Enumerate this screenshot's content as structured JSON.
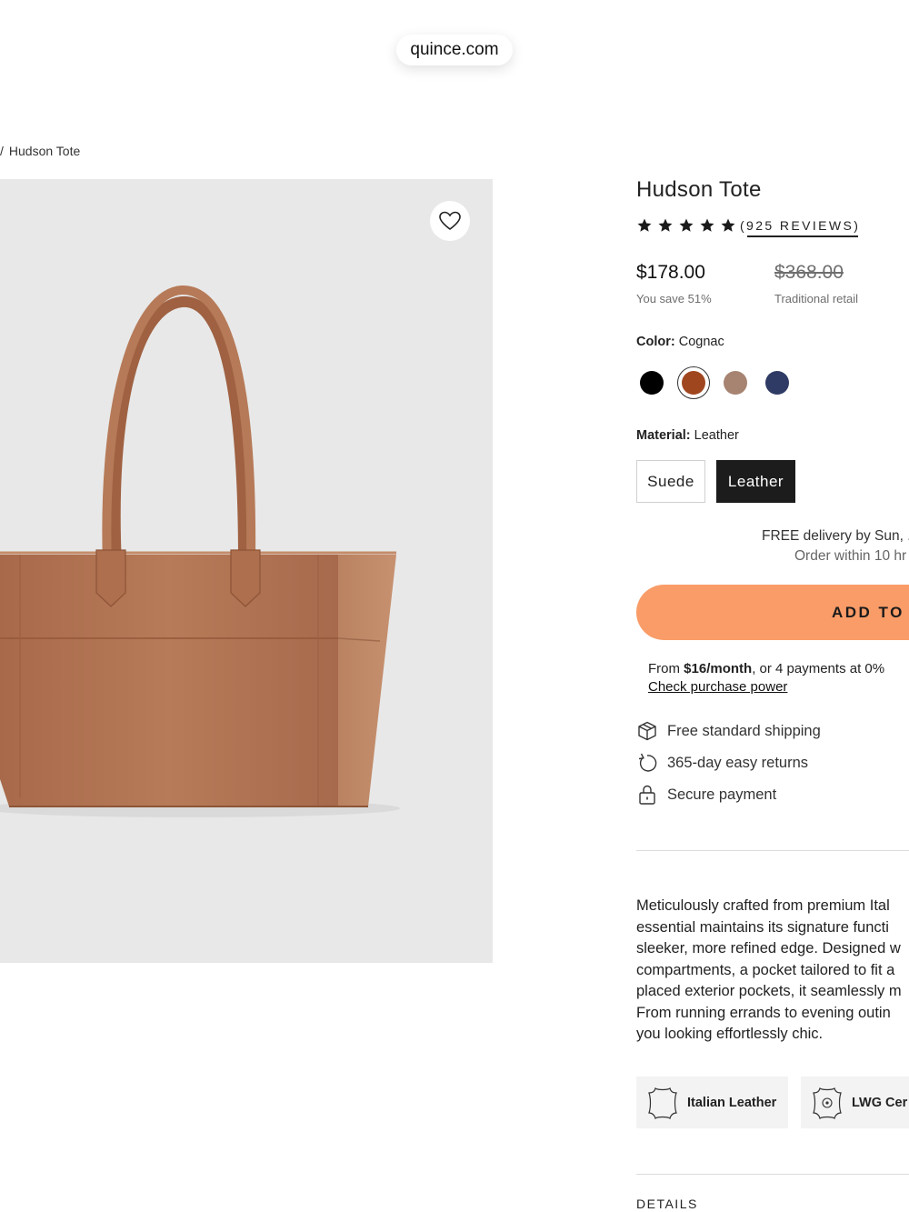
{
  "browser": {
    "url": "quince.com"
  },
  "breadcrumb": {
    "separator": "/",
    "current": "Hudson Tote"
  },
  "product": {
    "title": "Hudson Tote",
    "rating": 5,
    "reviews_label": "(925 REVIEWS)",
    "price": "$178.00",
    "savings": "You save 51%",
    "retail_price": "$368.00",
    "retail_label": "Traditional retail",
    "color_label": "Color:",
    "color_value": "Cognac",
    "swatches": [
      {
        "name": "Black",
        "hex": "#000000",
        "selected": false
      },
      {
        "name": "Cognac",
        "hex": "#a0461f",
        "selected": true
      },
      {
        "name": "Taupe",
        "hex": "#a78372",
        "selected": false
      },
      {
        "name": "Navy",
        "hex": "#2f3b64",
        "selected": false
      }
    ],
    "material_label": "Material:",
    "material_value": "Leather",
    "materials": [
      "Suede",
      "Leather"
    ],
    "delivery_text": "FREE delivery by Sun, .",
    "order_within": "Order within 10 hr",
    "add_to_bag": "ADD TO B",
    "finance_from": "From ",
    "finance_amount": "$16/month",
    "finance_rest": ", or 4 payments at 0%",
    "check_power": "Check purchase power",
    "perks": [
      "Free standard shipping",
      "365-day easy returns",
      "Secure payment"
    ],
    "description_lines": [
      "Meticulously crafted from premium Ital",
      "essential maintains its signature functi",
      "sleeker, more refined edge. Designed w",
      "compartments, a pocket tailored to fit a",
      "placed exterior pockets, it seamlessly m",
      "From running errands to evening outin",
      "you looking effortlessly chic."
    ],
    "badges": [
      "Italian Leather",
      "LWG Cer"
    ],
    "details_heading": "DETAILS"
  },
  "colors": {
    "accent_button": "#f99c68",
    "selected_material_bg": "#1c1c1c",
    "image_bg": "#e8e8e8",
    "bag_leather": "#b07552"
  }
}
